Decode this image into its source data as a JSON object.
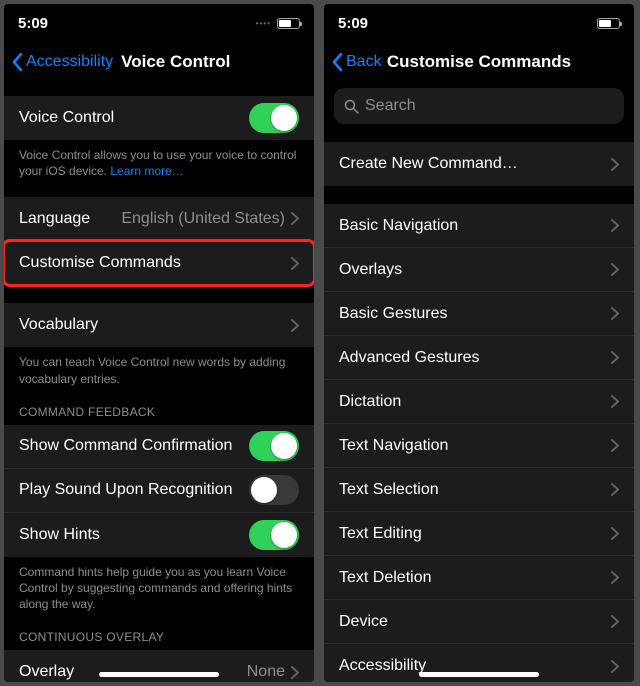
{
  "status": {
    "time": "5:09"
  },
  "left": {
    "back": "Accessibility",
    "title": "Voice Control",
    "voiceControl": {
      "label": "Voice Control",
      "on": true
    },
    "voiceControlFooter": "Voice Control allows you to use your voice to control your iOS device. ",
    "learnMore": "Learn more…",
    "language": {
      "label": "Language",
      "value": "English (United States)"
    },
    "customise": {
      "label": "Customise Commands"
    },
    "vocabulary": {
      "label": "Vocabulary"
    },
    "vocabFooter": "You can teach Voice Control new words by adding vocabulary entries.",
    "feedbackHeader": "COMMAND FEEDBACK",
    "confirm": {
      "label": "Show Command Confirmation",
      "on": true
    },
    "sound": {
      "label": "Play Sound Upon Recognition",
      "on": false
    },
    "hints": {
      "label": "Show Hints",
      "on": true
    },
    "hintsFooter": "Command hints help guide you as you learn Voice Control by suggesting commands and offering hints along the way.",
    "overlayHeader": "CONTINUOUS OVERLAY",
    "overlay": {
      "label": "Overlay",
      "value": "None"
    }
  },
  "right": {
    "back": "Back",
    "title": "Customise Commands",
    "searchPlaceholder": "Search",
    "create": "Create New Command…",
    "categories": [
      "Basic Navigation",
      "Overlays",
      "Basic Gestures",
      "Advanced Gestures",
      "Dictation",
      "Text Navigation",
      "Text Selection",
      "Text Editing",
      "Text Deletion",
      "Device",
      "Accessibility"
    ]
  }
}
